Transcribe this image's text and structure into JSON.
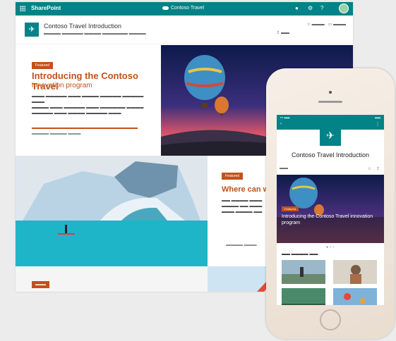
{
  "topbar": {
    "brand": "SharePoint",
    "center_label": "Contoso Travel"
  },
  "site": {
    "logo_glyph": "✈",
    "name": "Contoso Travel Introduction"
  },
  "hero": {
    "tag": "Featured",
    "headline_1": "Introducing the Contoso Travel",
    "headline_2": "innovation program"
  },
  "card2": {
    "tag": "Featured",
    "headline": "Where can we"
  },
  "phone": {
    "title": "Contoso Travel Introduction",
    "hero_headline": "Introducing the Contoso Travel innovation program"
  },
  "colors": {
    "accent": "#038387",
    "highlight": "#c4501a"
  }
}
